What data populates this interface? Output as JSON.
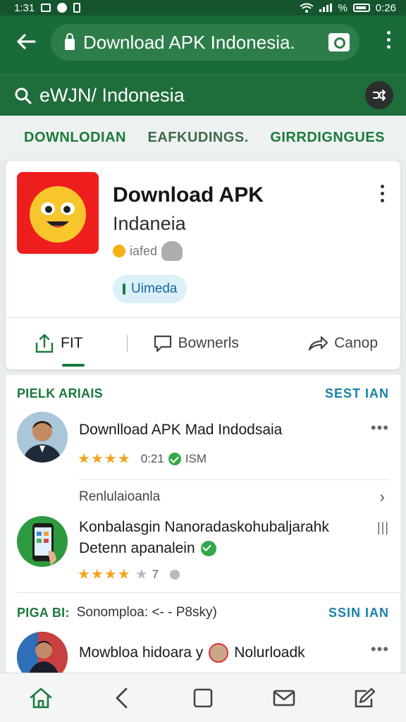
{
  "status_bar": {
    "time": "1:31",
    "right_text": "%",
    "battery_text": "0:26"
  },
  "browser": {
    "url_text": "Download APK Indonesia.",
    "search_query": "eWJN/ Indonesia"
  },
  "tabs": [
    "DOWNLODIAN",
    "EAFKUDINGS.",
    "GIRRDIGNGUES"
  ],
  "app": {
    "title": "Download APK",
    "subtitle": "Indaneia",
    "rated_text": "iafed",
    "chip_label": "Uimeda"
  },
  "actions": [
    {
      "label": "FIT",
      "icon": "share-up-icon"
    },
    {
      "label": "Bownerls",
      "icon": "comment-icon"
    },
    {
      "label": "Canop",
      "icon": "forward-icon"
    }
  ],
  "section1": {
    "title": "PIELK ARIAIS",
    "link": "SEST IAN"
  },
  "items": [
    {
      "title": "Downlload APK Mad Indodsaia",
      "rating": "★★★★",
      "meta": "0:21",
      "badge": "ISM",
      "avatar_color": "#3b7ea8"
    },
    {
      "subhead": "Renlulaioanla",
      "title_line1": "Konbalasgin Nanoradaskohubaljarahk",
      "title_line2": "Detenn apanalein",
      "rating": "★★★★",
      "half_star": "★",
      "meta": "7",
      "avatar_color": "#2e9a3f"
    }
  ],
  "section2": {
    "title": "PIGA BI:",
    "subtitle": "Sonomploa: <- - P8sky)",
    "link": "SSIN IAN"
  },
  "item3": {
    "title": "Mowbloa hidoara y",
    "title2": "Nolurloadk"
  },
  "bottom_nav": [
    "home-icon",
    "back-icon",
    "recents-icon",
    "mail-icon",
    "edit-icon"
  ],
  "colors": {
    "primary": "#1a6b3a",
    "accent": "#1a7a3d",
    "link": "#1781a8",
    "star": "#f3a51c",
    "icon_red": "#ef1e1e"
  }
}
